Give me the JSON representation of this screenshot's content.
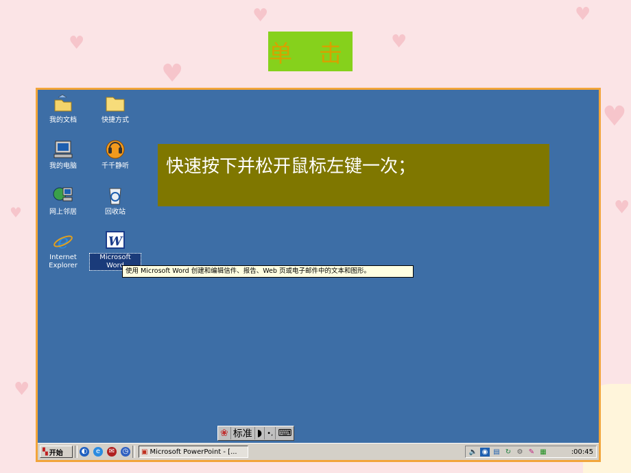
{
  "slide_title": "单 击",
  "callout_text": "快速按下并松开鼠标左键一次；",
  "desktop_icons": [
    {
      "label": "我的文档"
    },
    {
      "label": "快捷方式"
    },
    {
      "label": "我的电脑"
    },
    {
      "label": "千千静听"
    },
    {
      "label": "网上邻居"
    },
    {
      "label": "回收站"
    },
    {
      "label": "Internet Explorer"
    },
    {
      "label": "Microsoft Word"
    }
  ],
  "tooltip": "使用 Microsoft Word 创建和编辑信件、报告、Web 页或电子邮件中的文本和图形。",
  "ime_bar": {
    "mode_label": "标准"
  },
  "taskbar": {
    "start_label": "开始",
    "task_label": "Microsoft PowerPoint - [...",
    "clock": ":00:45"
  },
  "colors": {
    "desktop": "#3d6ea6",
    "callout": "#7f7700",
    "title_box": "#86d11c",
    "frame": "#f2a53a"
  }
}
